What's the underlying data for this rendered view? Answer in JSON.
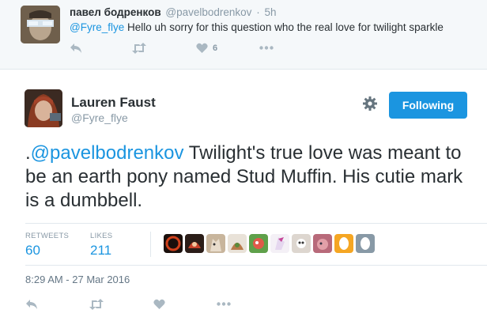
{
  "reply": {
    "display_name": "павел бодренков",
    "handle": "@pavelbodrenkov",
    "separator": "·",
    "time": "5h",
    "mention": "@Fyre_flye",
    "text": " Hello uh sorry for this question who the real love for twilight sparkle",
    "likes": "6",
    "icons": [
      "reply-icon",
      "retweet-icon",
      "heart-icon",
      "more-icon"
    ]
  },
  "tweet": {
    "display_name": "Lauren Faust",
    "handle": "@Fyre_flye",
    "follow_label": "Following",
    "text_prefix": ".",
    "mention": "@pavelbodrenkov",
    "text": " Twilight's true love was meant to be an earth pony named Stud Muffin. His cutie mark is a dumbbell.",
    "retweets_label": "RETWEETS",
    "retweets": "60",
    "likes_label": "LIKES",
    "likes": "211",
    "timestamp": "8:29 AM - 27 Mar 2016",
    "icons": [
      "gear-icon",
      "reply-icon",
      "retweet-icon",
      "heart-icon",
      "more-icon"
    ]
  },
  "colors": {
    "accent": "#1b95e0",
    "muted": "#8899a6",
    "icon": "#aab8c2",
    "reply_bg": "#f5f8fa"
  }
}
